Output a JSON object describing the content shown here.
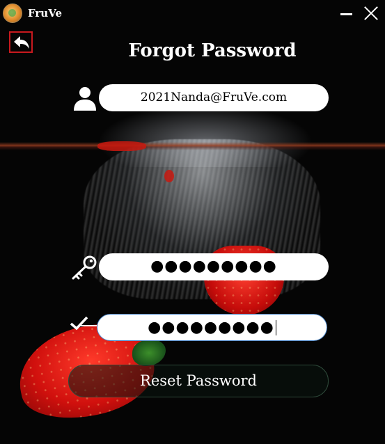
{
  "app": {
    "title": "FruVe"
  },
  "header": {
    "title": "Forgot Password"
  },
  "form": {
    "email": {
      "value": "2021Nanda@FruVe.com"
    },
    "password": {
      "masked_value": "●●●●●●●●●"
    },
    "confirm_password": {
      "masked_value": "●●●●●●●●●"
    },
    "reset_label": "Reset Password"
  },
  "colors": {
    "back_border": "#c8191e",
    "input_bg": "#ffffff",
    "focus_border": "#4c86c8"
  },
  "icons": [
    "app-logo",
    "minimize-icon",
    "close-icon",
    "back-arrow-icon",
    "user-icon",
    "key-icon",
    "check-icon"
  ]
}
